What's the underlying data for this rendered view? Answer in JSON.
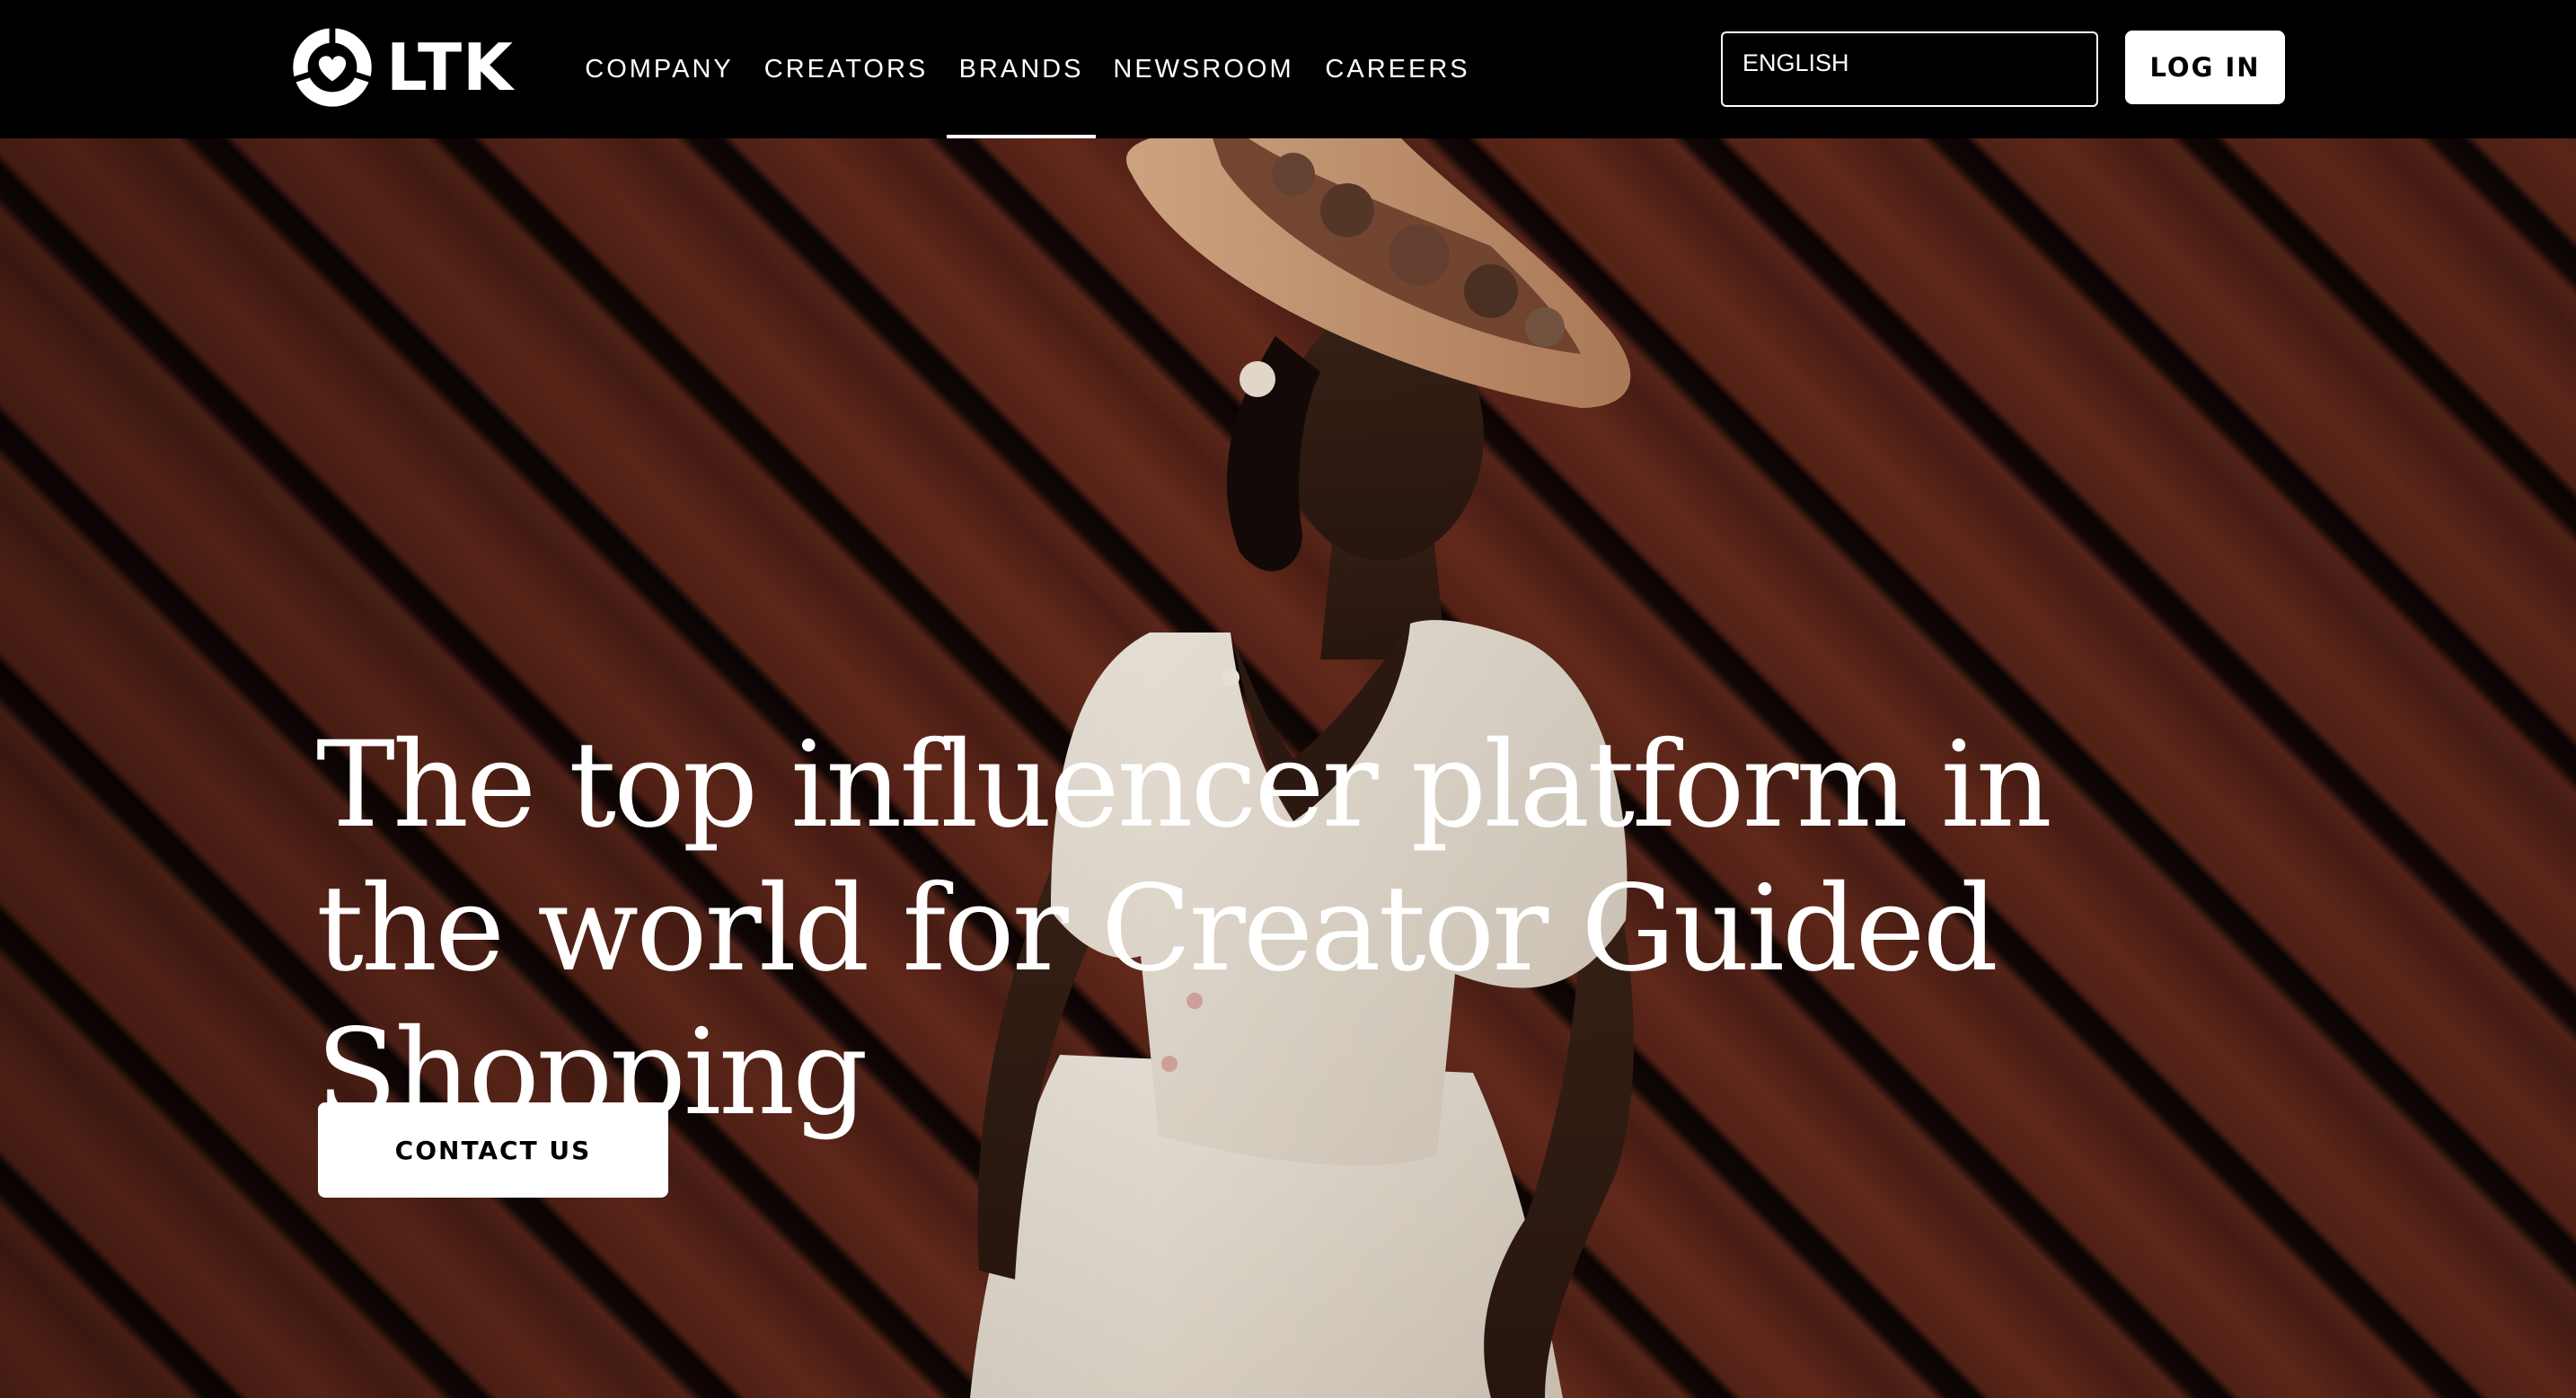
{
  "header": {
    "logo_text": "LTK",
    "nav": [
      {
        "label": "COMPANY",
        "active": false
      },
      {
        "label": "CREATORS",
        "active": false
      },
      {
        "label": "BRANDS",
        "active": true
      },
      {
        "label": "NEWSROOM",
        "active": false
      },
      {
        "label": "CAREERS",
        "active": false
      }
    ],
    "language": {
      "selected": "ENGLISH"
    },
    "login_label": "LOG IN"
  },
  "hero": {
    "headline": "The top influencer platform in the world for Creator Guided Shopping",
    "cta_label": "CONTACT US"
  },
  "colors": {
    "header_bg": "#000000",
    "button_bg": "#ffffff",
    "text_light": "#ffffff",
    "wood": "#5a2418"
  }
}
